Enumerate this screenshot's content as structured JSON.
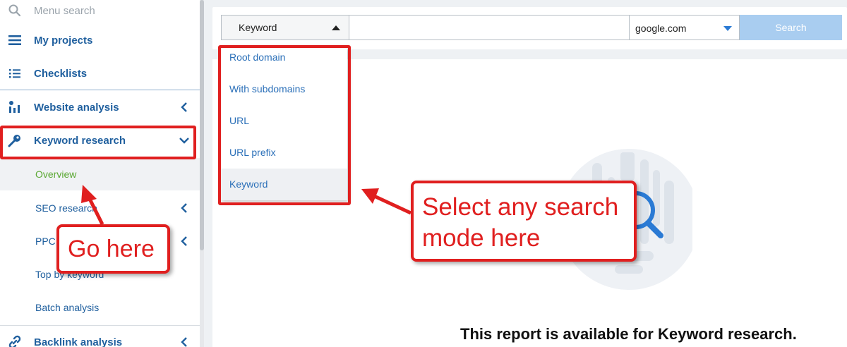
{
  "sidebar": {
    "menu_search_placeholder": "Menu search",
    "items": [
      {
        "label": "My projects"
      },
      {
        "label": "Checklists"
      },
      {
        "label": "Website analysis"
      },
      {
        "label": "Keyword research"
      },
      {
        "label": "Backlink analysis"
      }
    ],
    "subitems": [
      {
        "label": "Overview"
      },
      {
        "label": "SEO research"
      },
      {
        "label": "PPC research"
      },
      {
        "label": "Top by keyword"
      },
      {
        "label": "Batch analysis"
      }
    ]
  },
  "search_bar": {
    "mode_label": "Keyword",
    "query_value": "",
    "database_label": "google.com",
    "search_label": "Search"
  },
  "dropdown": {
    "options": [
      {
        "label": "Root domain"
      },
      {
        "label": "With subdomains"
      },
      {
        "label": "URL"
      },
      {
        "label": "URL prefix"
      },
      {
        "label": "Keyword"
      }
    ],
    "selected": "Keyword"
  },
  "annotations": {
    "go_here": "Go here",
    "select_line1": "Select any search",
    "select_line2": "mode here"
  },
  "main": {
    "report_text": "This report is available for Keyword research."
  },
  "colors": {
    "annotation_red": "#e01f1f",
    "link_blue": "#1f5f9e",
    "active_green": "#5aa832",
    "search_button": "#a9cdf0"
  }
}
